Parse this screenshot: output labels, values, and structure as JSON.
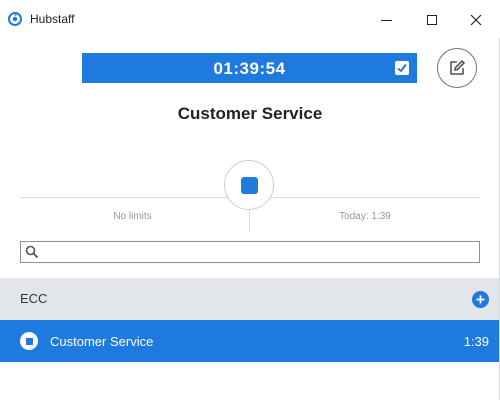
{
  "window": {
    "title": "Hubstaff",
    "colors": {
      "accent": "#1f7ae0",
      "project_bg": "#e2e5ea"
    }
  },
  "timer": {
    "time": "01:39:54"
  },
  "current_task": {
    "title": "Customer Service"
  },
  "limits": {
    "limit_text": "No limits",
    "today_text": "Today: 1:39"
  },
  "search": {
    "value": "",
    "placeholder": ""
  },
  "project": {
    "name": "ECC"
  },
  "tasks": [
    {
      "name": "Customer Service",
      "time": "1:39",
      "active": true
    }
  ],
  "icons": {
    "logo": "hubstaff-logo-icon",
    "minimize": "minimize-icon",
    "maximize": "maximize-icon",
    "close": "close-icon",
    "timer_check": "checkbox-icon",
    "edit": "edit-note-icon",
    "stop": "stop-icon",
    "search": "search-icon",
    "add": "plus-icon"
  }
}
